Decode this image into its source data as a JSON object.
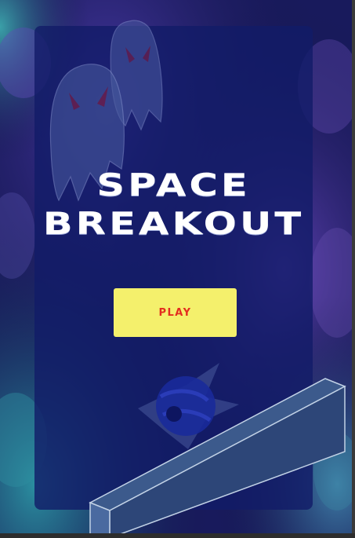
{
  "game": {
    "title_line1": "SPACE",
    "title_line2": "BREAKOUT",
    "play_label": "PLAY"
  },
  "colors": {
    "panel": "#121c68",
    "button_bg": "#f4f06c",
    "button_text": "#e32d1f",
    "title_text": "#ffffff"
  },
  "icons": [
    "alien-ghost-icon",
    "alien-ghost-icon",
    "planet-icon",
    "paddle-brick"
  ]
}
